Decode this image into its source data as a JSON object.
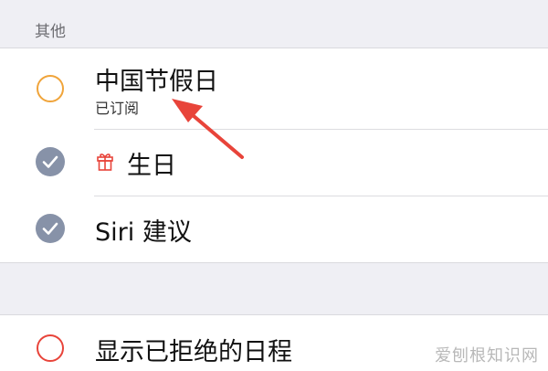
{
  "section": {
    "header": "其他"
  },
  "calendars": [
    {
      "title": "中国节假日",
      "subtitle": "已订阅",
      "checked": false,
      "circle_color": "#f0a43a"
    },
    {
      "title": "生日",
      "checked": true,
      "icon": "gift-icon",
      "icon_color": "#e8443a"
    },
    {
      "title": "Siri 建议",
      "checked": true
    }
  ],
  "declined": {
    "title": "显示已拒绝的日程",
    "checked": false,
    "circle_color": "#e8443a"
  },
  "watermark": "爱刨根知识网",
  "colors": {
    "check_fill": "#8792a8",
    "annotation_arrow": "#e8443a"
  }
}
